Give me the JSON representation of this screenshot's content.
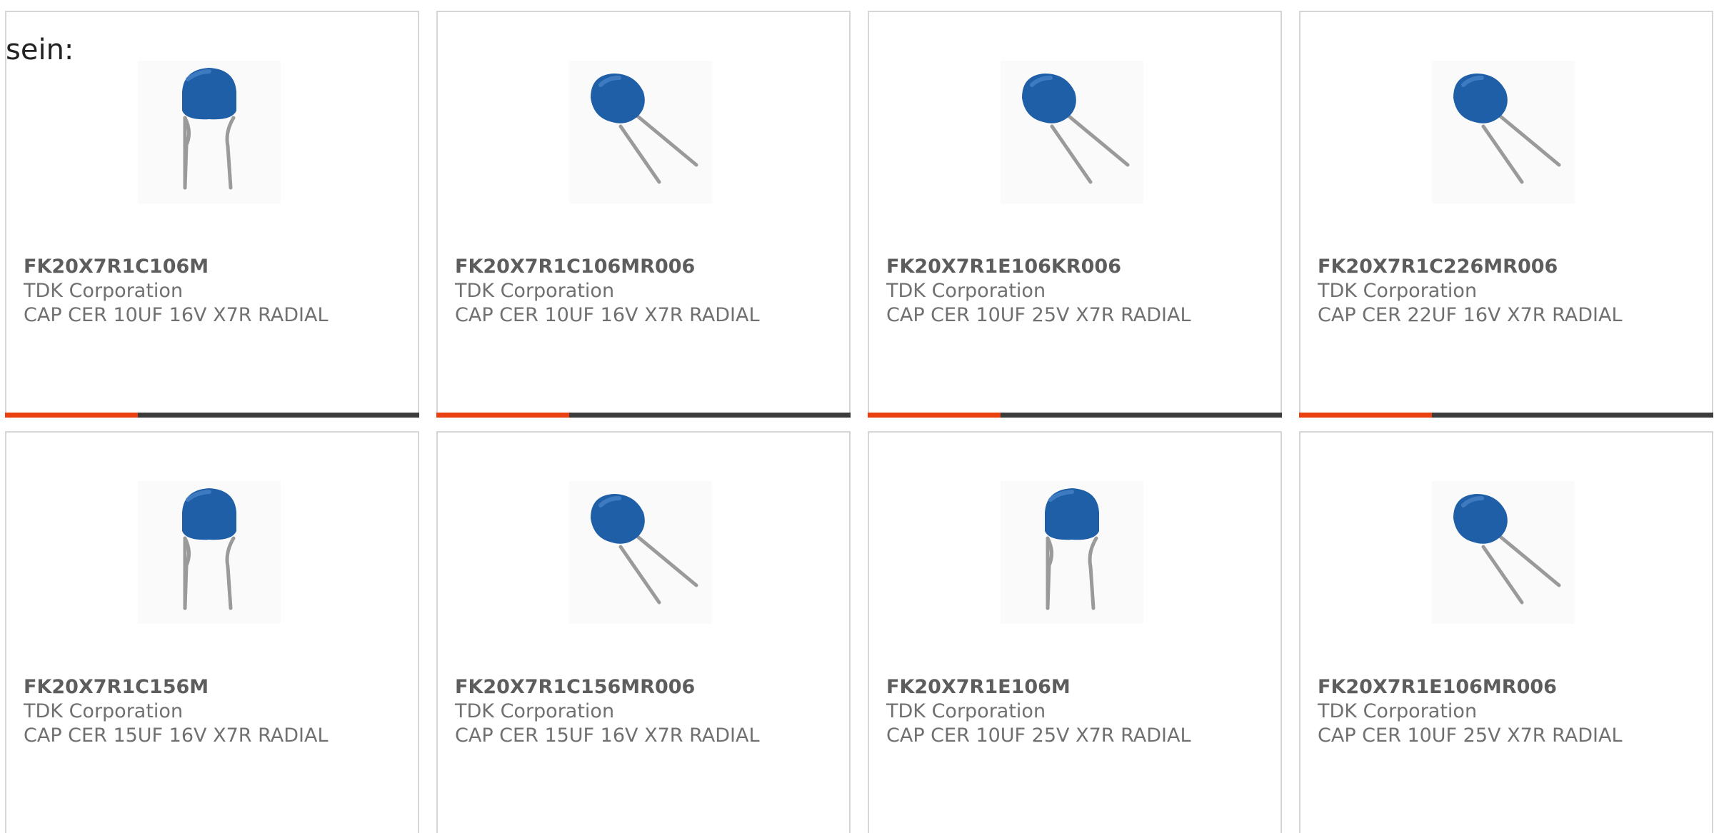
{
  "intro": {
    "text": "sein:"
  },
  "colors": {
    "accent": "#e8410f",
    "bar_track": "#3c3c3c",
    "card_border": "#d6d6d6",
    "part_text": "#5d5d5d",
    "meta_text": "#707070",
    "capacitor_body": "#1f5fa8",
    "capacitor_leads": "#9a9a9a"
  },
  "products": [
    {
      "part_number": "FK20X7R1C106M",
      "manufacturer": "TDK Corporation",
      "description": "CAP CER 10UF 16V X7R RADIAL",
      "image_icon": "radial-capacitor-upright-icon",
      "progress": 0.32
    },
    {
      "part_number": "FK20X7R1C106MR006",
      "manufacturer": "TDK Corporation",
      "description": "CAP CER 10UF 16V X7R RADIAL",
      "image_icon": "radial-capacitor-tilted-icon",
      "progress": 0.32
    },
    {
      "part_number": "FK20X7R1E106KR006",
      "manufacturer": "TDK Corporation",
      "description": "CAP CER 10UF 25V X7R RADIAL",
      "image_icon": "radial-capacitor-tilted-icon",
      "progress": 0.32
    },
    {
      "part_number": "FK20X7R1C226MR006",
      "manufacturer": "TDK Corporation",
      "description": "CAP CER 22UF 16V X7R RADIAL",
      "image_icon": "radial-capacitor-tilted-icon",
      "progress": 0.32
    },
    {
      "part_number": "FK20X7R1C156M",
      "manufacturer": "TDK Corporation",
      "description": "CAP CER 15UF 16V X7R RADIAL",
      "image_icon": "radial-capacitor-upright-icon"
    },
    {
      "part_number": "FK20X7R1C156MR006",
      "manufacturer": "TDK Corporation",
      "description": "CAP CER 15UF 16V X7R RADIAL",
      "image_icon": "radial-capacitor-tilted-icon"
    },
    {
      "part_number": "FK20X7R1E106M",
      "manufacturer": "TDK Corporation",
      "description": "CAP CER 10UF 25V X7R RADIAL",
      "image_icon": "radial-capacitor-upright-icon"
    },
    {
      "part_number": "FK20X7R1E106MR006",
      "manufacturer": "TDK Corporation",
      "description": "CAP CER 10UF 25V X7R RADIAL",
      "image_icon": "radial-capacitor-tilted-icon"
    }
  ]
}
